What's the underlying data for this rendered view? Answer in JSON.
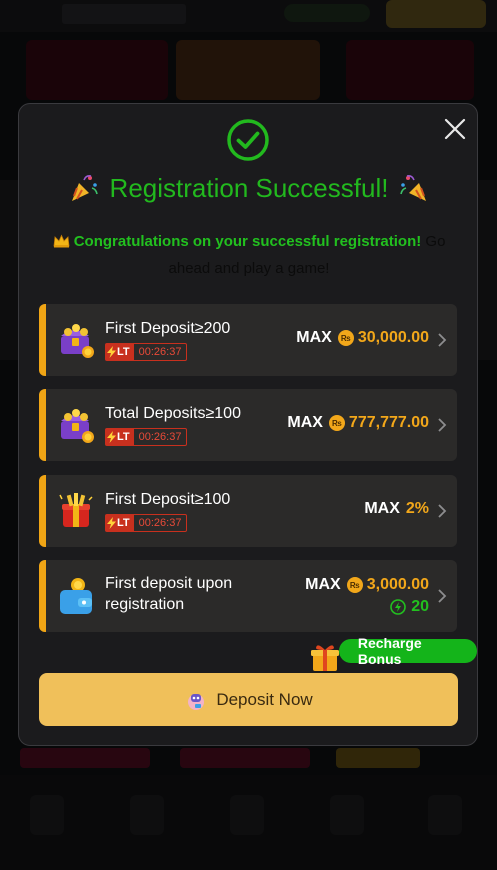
{
  "modal": {
    "title": "Registration Successful!",
    "congrats_highlight": "Congratulations on your successful registration!",
    "congrats_rest": " Go ahead and play a game!"
  },
  "cards": [
    {
      "name": "First Deposit≥200",
      "lt_label": "LT",
      "timer": "00:26:37",
      "max_label": "MAX",
      "amount": "30,000.00",
      "currency_icon": "rupee-coin-icon"
    },
    {
      "name": "Total Deposits≥100",
      "lt_label": "LT",
      "timer": "00:26:37",
      "max_label": "MAX",
      "amount": "777,777.00",
      "currency_icon": "rupee-coin-icon"
    },
    {
      "name": "First Deposit≥100",
      "lt_label": "LT",
      "timer": "00:26:37",
      "max_label": "MAX",
      "amount": "2%"
    },
    {
      "name": "First deposit upon registration",
      "max_label": "MAX",
      "amount": "3,000.00",
      "bonus": "20",
      "currency_icon": "rupee-coin-icon"
    }
  ],
  "recharge_badge": "Recharge Bonus",
  "deposit_button": "Deposit Now",
  "colors": {
    "success_green": "#22b91e",
    "accent_orange": "#f2a71a",
    "deposit_button": "#f0c05a",
    "timer_red": "#c8301e"
  }
}
